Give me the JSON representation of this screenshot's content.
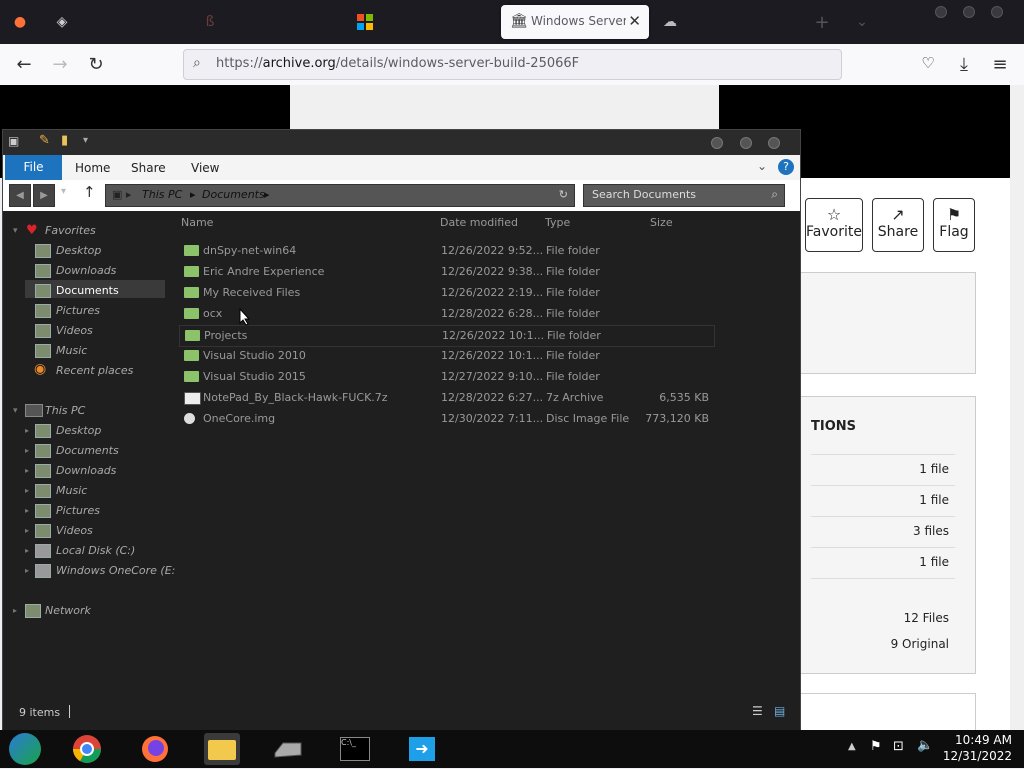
{
  "browser": {
    "active_tab_title": "Windows Server B",
    "url_prefix": "https://",
    "url_domain": "archive.org",
    "url_path": "/details/windows-server-build-25066F"
  },
  "webpage": {
    "favorite_label": "Favorite",
    "share_label": "Share",
    "flag_label": "Flag",
    "section_heading": "TIONS",
    "rows": [
      "1 file",
      "1 file",
      "3 files",
      "1 file"
    ],
    "total_files": "12 Files",
    "original_count": "9 Original"
  },
  "explorer": {
    "ribbon_tabs": {
      "file": "File",
      "home": "Home",
      "share": "Share",
      "view": "View"
    },
    "breadcrumb": [
      "This PC",
      "Documents"
    ],
    "search_placeholder": "Search Documents",
    "columns": {
      "name": "Name",
      "date": "Date modified",
      "type": "Type",
      "size": "Size"
    },
    "nav": {
      "favorites": "Favorites",
      "fav_items": [
        "Desktop",
        "Downloads",
        "Documents",
        "Pictures",
        "Videos",
        "Music",
        "Recent places"
      ],
      "thispc": "This PC",
      "pc_items": [
        "Desktop",
        "Documents",
        "Downloads",
        "Music",
        "Pictures",
        "Videos",
        "Local Disk (C:)",
        "Windows OneCore (E:"
      ],
      "network": "Network"
    },
    "files": [
      {
        "name": "dnSpy-net-win64",
        "date": "12/26/2022 9:52...",
        "type": "File folder",
        "size": ""
      },
      {
        "name": "Eric Andre Experience",
        "date": "12/26/2022 9:38...",
        "type": "File folder",
        "size": ""
      },
      {
        "name": "My Received Files",
        "date": "12/26/2022 2:19...",
        "type": "File folder",
        "size": ""
      },
      {
        "name": "ocx",
        "date": "12/28/2022 6:28...",
        "type": "File folder",
        "size": ""
      },
      {
        "name": "Projects",
        "date": "12/26/2022 10:1...",
        "type": "File folder",
        "size": ""
      },
      {
        "name": "Visual Studio 2010",
        "date": "12/26/2022 10:1...",
        "type": "File folder",
        "size": ""
      },
      {
        "name": "Visual Studio 2015",
        "date": "12/27/2022 9:10...",
        "type": "File folder",
        "size": ""
      },
      {
        "name": "NotePad_By_Black-Hawk-FUCK.7z",
        "date": "12/28/2022 6:27...",
        "type": "7z Archive",
        "size": "6,535 KB"
      },
      {
        "name": "OneCore.img",
        "date": "12/30/2022 7:11...",
        "type": "Disc Image File",
        "size": "773,120 KB"
      }
    ],
    "status": "9 items"
  },
  "taskbar": {
    "time": "10:49 AM",
    "date": "12/31/2022"
  },
  "colors": {
    "accent": "#1e73be",
    "folder": "#8cc36a",
    "explorer_bg": "#1f1f1f"
  }
}
